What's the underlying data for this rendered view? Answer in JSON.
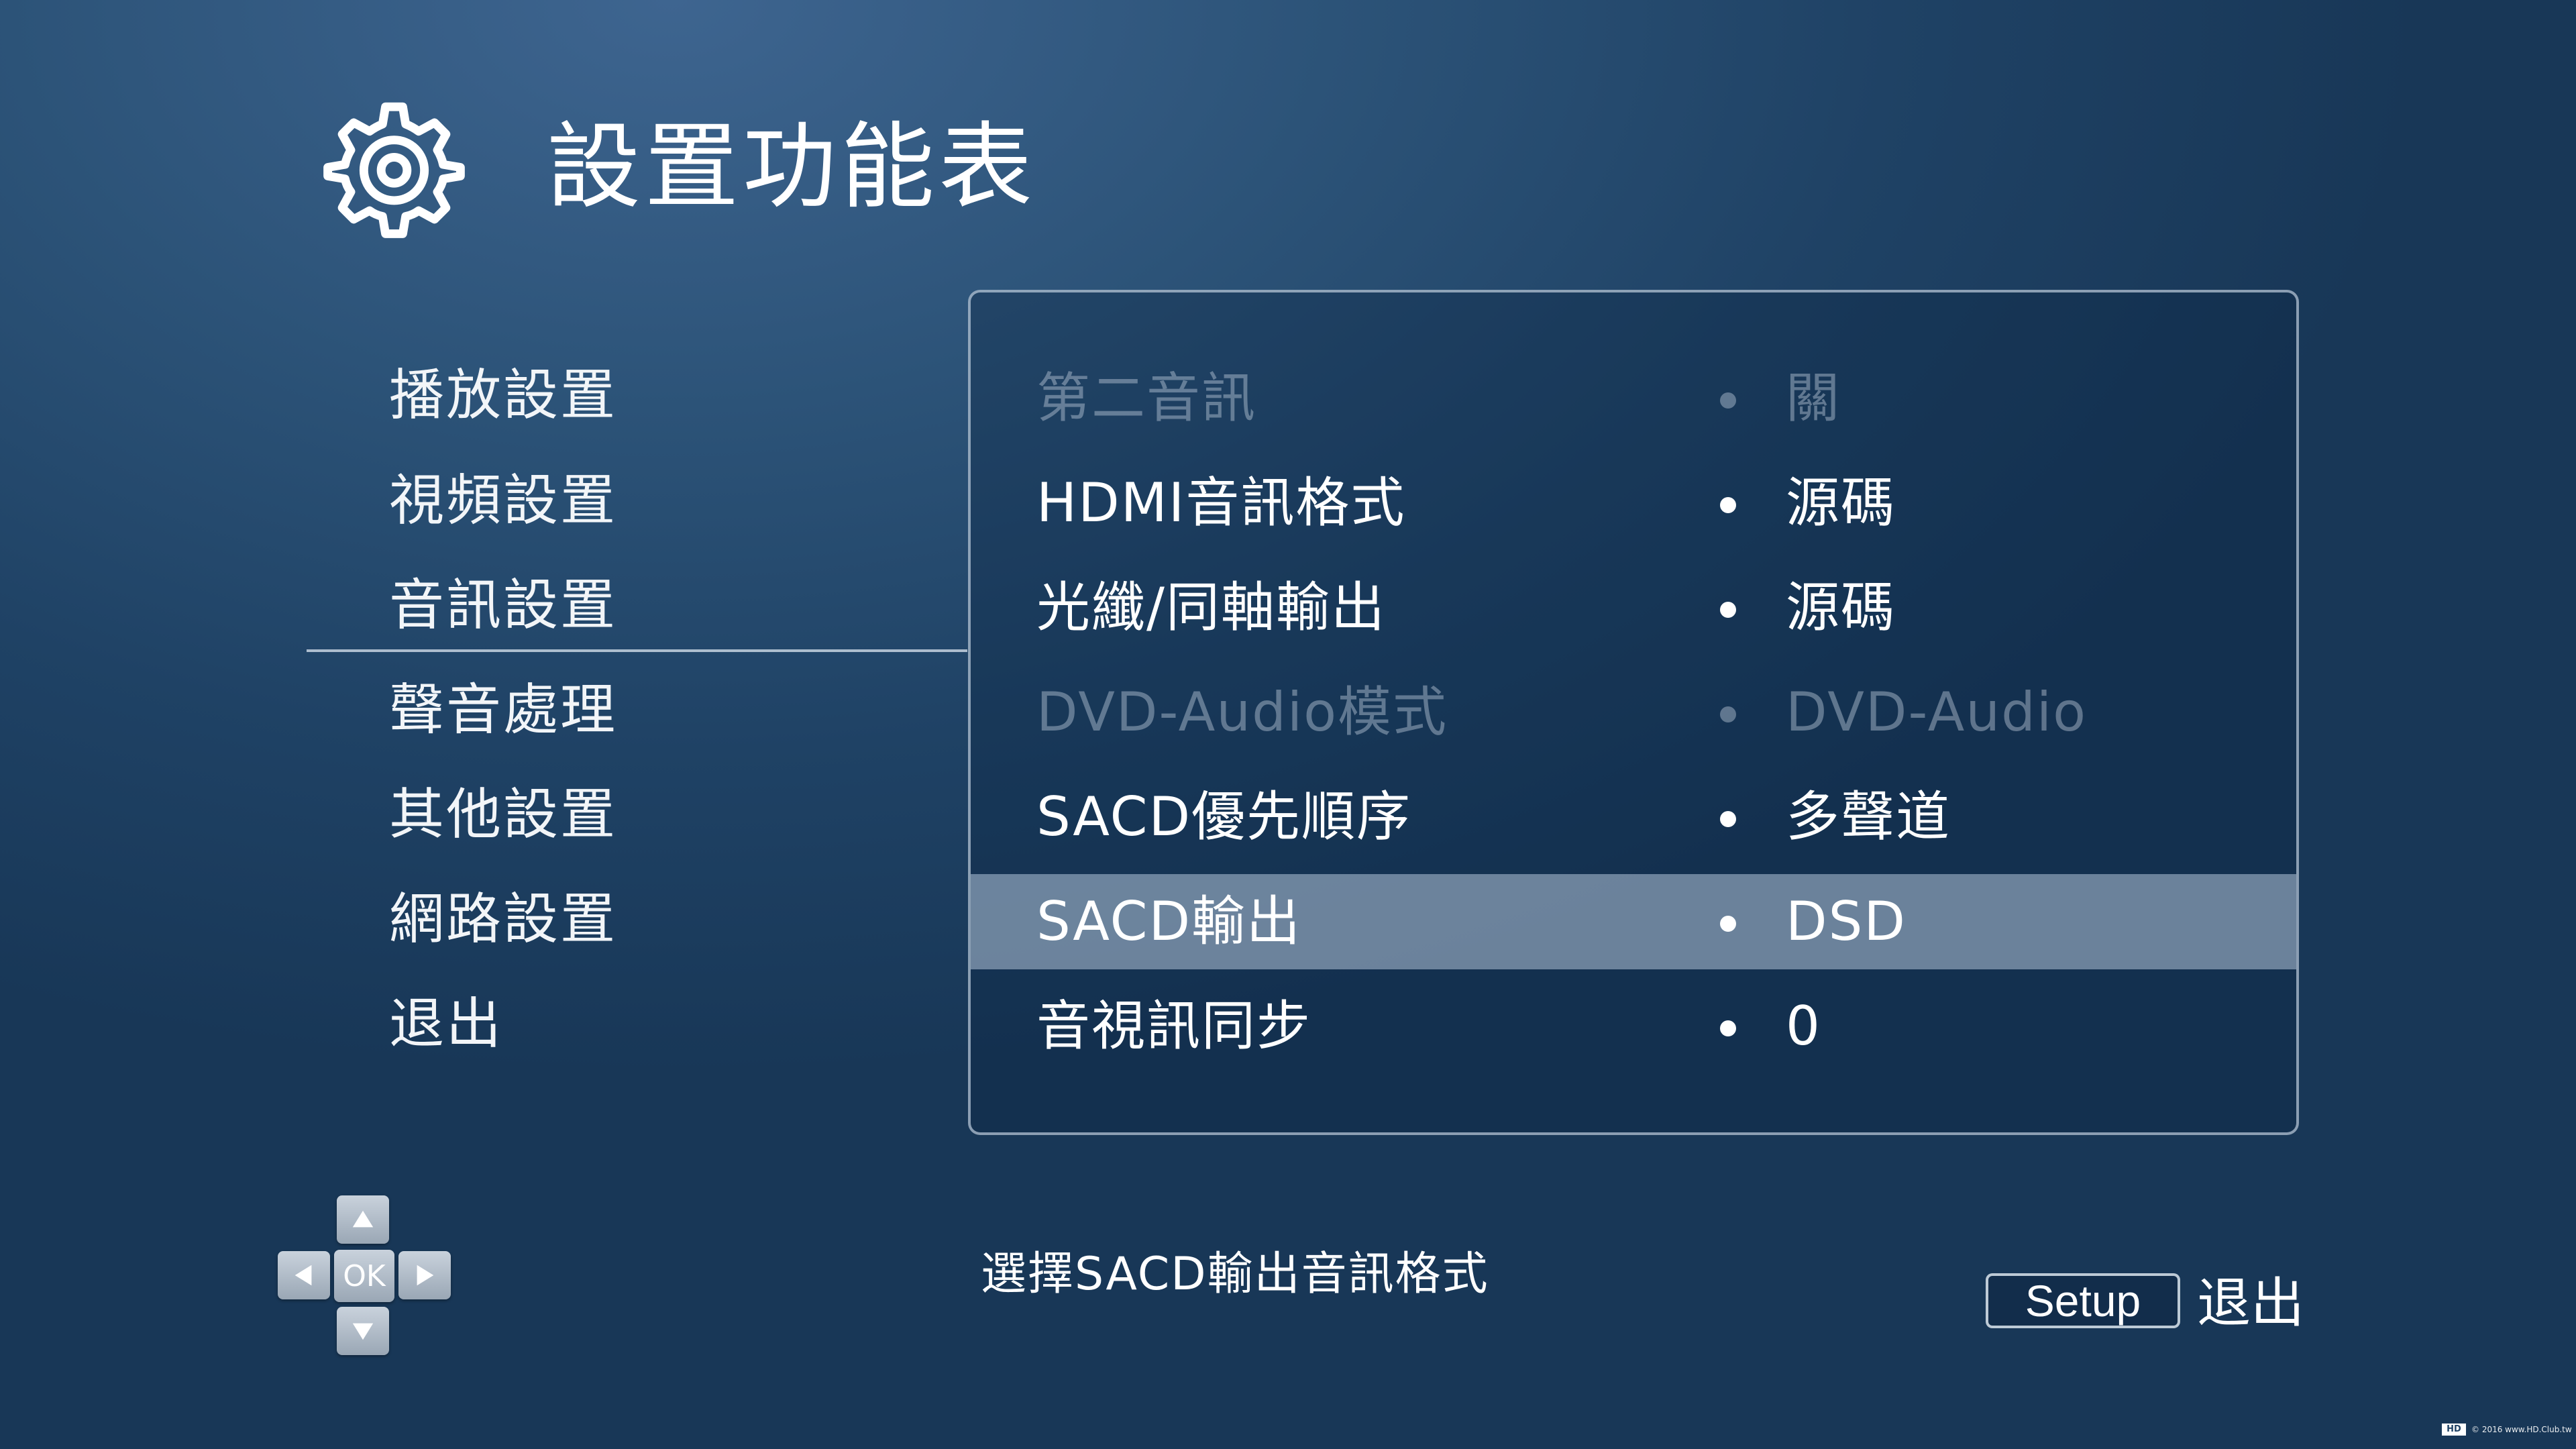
{
  "header": {
    "title": "設置功能表",
    "icon": "gear-icon"
  },
  "menu": {
    "items": [
      {
        "label": "播放設置"
      },
      {
        "label": "視頻設置"
      },
      {
        "label": "音訊設置",
        "active": true
      },
      {
        "label": "聲音處理"
      },
      {
        "label": "其他設置"
      },
      {
        "label": "網路設置"
      },
      {
        "label": "退出"
      }
    ]
  },
  "settings": {
    "rows": [
      {
        "label": "第二音訊",
        "value": "關",
        "disabled": true
      },
      {
        "label": "HDMI音訊格式",
        "value": "源碼"
      },
      {
        "label": "光纖/同軸輸出",
        "value": "源碼"
      },
      {
        "label": "DVD-Audio模式",
        "value": "DVD-Audio",
        "disabled": true
      },
      {
        "label": "SACD優先順序",
        "value": "多聲道"
      },
      {
        "label": "SACD輸出",
        "value": "DSD",
        "selected": true
      },
      {
        "label": "音視訊同步",
        "value": "0"
      }
    ]
  },
  "navigation": {
    "ok_label": "OK"
  },
  "hint": {
    "text": "選擇SACD輸出音訊格式"
  },
  "footer": {
    "setup_label": "Setup",
    "exit_label": "退出"
  },
  "watermark": {
    "logo": "HD",
    "text": "© 2016 www.HD.Club.tw"
  },
  "colors": {
    "background": "#2c5378",
    "selected_row": "#7d93ab",
    "disabled_text": "#8ea3ba"
  }
}
